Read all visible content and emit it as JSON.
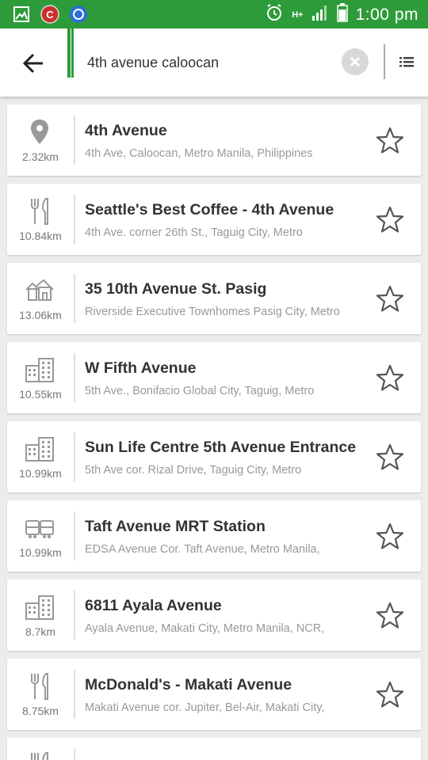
{
  "status_bar": {
    "time": "1:00 pm",
    "network": "H+"
  },
  "search": {
    "query": "4th avenue caloocan"
  },
  "results": [
    {
      "icon": "location-pin-icon",
      "distance": "2.32km",
      "title": "4th Avenue",
      "subtitle": "4th Ave, Caloocan, Metro Manila, Philippines"
    },
    {
      "icon": "restaurant-icon",
      "distance": "10.84km",
      "title": "Seattle's Best Coffee - 4th Avenue",
      "subtitle": "4th Ave. corner 26th St., Taguig City, Metro"
    },
    {
      "icon": "house-icon",
      "distance": "13.06km",
      "title": "35 10th Avenue St. Pasig",
      "subtitle": "Riverside Executive Townhomes Pasig City, Metro"
    },
    {
      "icon": "building-icon",
      "distance": "10.55km",
      "title": "W Fifth Avenue",
      "subtitle": "5th Ave., Bonifacio Global City, Taguig, Metro"
    },
    {
      "icon": "building-icon",
      "distance": "10.99km",
      "title": "Sun Life Centre 5th Avenue Entrance",
      "subtitle": "5th Ave cor. Rizal Drive, Taguig City, Metro"
    },
    {
      "icon": "transit-icon",
      "distance": "10.99km",
      "title": "Taft Avenue MRT Station",
      "subtitle": "EDSA Avenue Cor. Taft Avenue, Metro Manila,"
    },
    {
      "icon": "building-icon",
      "distance": "8.7km",
      "title": "6811 Ayala Avenue",
      "subtitle": "Ayala Avenue, Makati City, Metro Manila, NCR,"
    },
    {
      "icon": "restaurant-icon",
      "distance": "8.75km",
      "title": "McDonald's - Makati Avenue",
      "subtitle": "Makati Avenue cor. Jupiter, Bel-Air, Makati City,"
    },
    {
      "icon": "restaurant-icon",
      "distance": "",
      "title": "",
      "subtitle": ""
    }
  ]
}
